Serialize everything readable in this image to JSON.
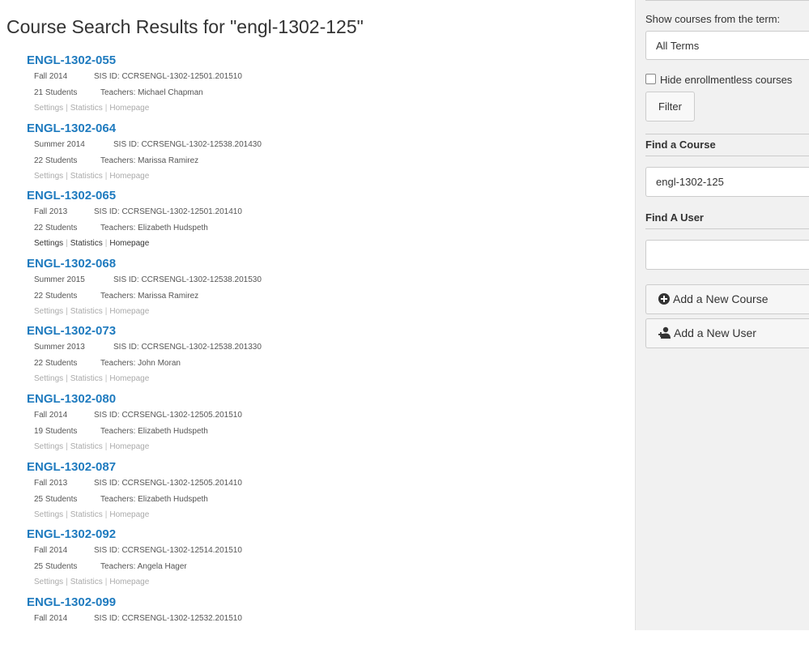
{
  "page": {
    "title": "Course Search Results for \"engl-1302-125\""
  },
  "courses": [
    {
      "name": "ENGL-1302-055",
      "term": "Fall 2014",
      "sis": "SIS ID: CCRSENGL-1302-12501.201510",
      "students": "21 Students",
      "teachers": "Teachers: Michael Chapman"
    },
    {
      "name": "ENGL-1302-064",
      "term": "Summer 2014",
      "sis": "SIS ID: CCRSENGL-1302-12538.201430",
      "students": "22 Students",
      "teachers": "Teachers: Marissa Ramirez"
    },
    {
      "name": "ENGL-1302-065",
      "term": "Fall 2013",
      "sis": "SIS ID: CCRSENGL-1302-12501.201410",
      "students": "22 Students",
      "teachers": "Teachers: Elizabeth Hudspeth"
    },
    {
      "name": "ENGL-1302-068",
      "term": "Summer 2015",
      "sis": "SIS ID: CCRSENGL-1302-12538.201530",
      "students": "22 Students",
      "teachers": "Teachers: Marissa Ramirez"
    },
    {
      "name": "ENGL-1302-073",
      "term": "Summer 2013",
      "sis": "SIS ID: CCRSENGL-1302-12538.201330",
      "students": "22 Students",
      "teachers": "Teachers: John Moran"
    },
    {
      "name": "ENGL-1302-080",
      "term": "Fall 2014",
      "sis": "SIS ID: CCRSENGL-1302-12505.201510",
      "students": "19 Students",
      "teachers": "Teachers: Elizabeth Hudspeth"
    },
    {
      "name": "ENGL-1302-087",
      "term": "Fall 2013",
      "sis": "SIS ID: CCRSENGL-1302-12505.201410",
      "students": "25 Students",
      "teachers": "Teachers: Elizabeth Hudspeth"
    },
    {
      "name": "ENGL-1302-092",
      "term": "Fall 2014",
      "sis": "SIS ID: CCRSENGL-1302-12514.201510",
      "students": "25 Students",
      "teachers": "Teachers: Angela Hager"
    },
    {
      "name": "ENGL-1302-099",
      "term": "Fall 2014",
      "sis": "SIS ID: CCRSENGL-1302-12532.201510",
      "students": "",
      "teachers": ""
    }
  ],
  "course_actions": {
    "settings": "Settings",
    "statistics": "Statistics",
    "homepage": "Homepage",
    "separator": "|",
    "highlighted_index": 2
  },
  "sidebar": {
    "term_label": "Show courses from the term:",
    "term_value": "All Terms",
    "hide_label": "Hide enrollmentless courses",
    "filter_label": "Filter",
    "find_course_label": "Find a Course",
    "find_course_value": "engl-1302-125",
    "find_user_label": "Find A User",
    "find_user_value": "",
    "add_course_label": "Add a New Course",
    "add_user_label": "Add a New User"
  },
  "colors": {
    "link": "#1f7bbf",
    "sidebar_bg": "#f1f1f1"
  },
  "icons": {
    "add_course": "plus-circle-icon",
    "add_user": "add-user-icon"
  }
}
